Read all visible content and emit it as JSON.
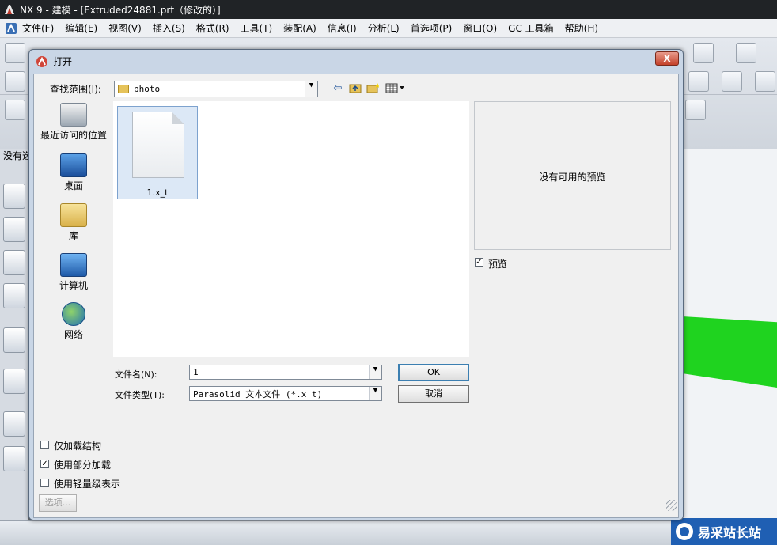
{
  "window": {
    "title": "NX 9 - 建模 - [Extruded24881.prt（修改的）]",
    "menus": [
      "文件(F)",
      "编辑(E)",
      "视图(V)",
      "插入(S)",
      "格式(R)",
      "工具(T)",
      "装配(A)",
      "信息(I)",
      "分析(L)",
      "首选项(P)",
      "窗口(O)",
      "GC 工具箱",
      "帮助(H)"
    ],
    "status_text": "没有选"
  },
  "dialog": {
    "title": "打开",
    "close_label": "X",
    "look_in_label": "查找范围(I):",
    "look_in_value": "photo",
    "places": [
      "最近访问的位置",
      "桌面",
      "库",
      "计算机",
      "网络"
    ],
    "files": [
      {
        "name": "1.x_t"
      }
    ],
    "preview_message": "没有可用的预览",
    "preview_checkbox": {
      "label": "预览",
      "checked": true
    },
    "filename_label": "文件名(N):",
    "filename_value": "1",
    "filetype_label": "文件类型(T):",
    "filetype_value": "Parasolid 文本文件 (*.x_t)",
    "ok_label": "OK",
    "cancel_label": "取消",
    "options": [
      {
        "label": "仅加载结构",
        "checked": false
      },
      {
        "label": "使用部分加载",
        "checked": true
      },
      {
        "label": "使用轻量级表示",
        "checked": false
      }
    ],
    "options_button_label": "选项..."
  },
  "watermark": {
    "text": "易采站长站"
  },
  "colors": {
    "accent": "#3c7fb1",
    "selection": "#dce8f6",
    "model": "#1fd31f"
  }
}
